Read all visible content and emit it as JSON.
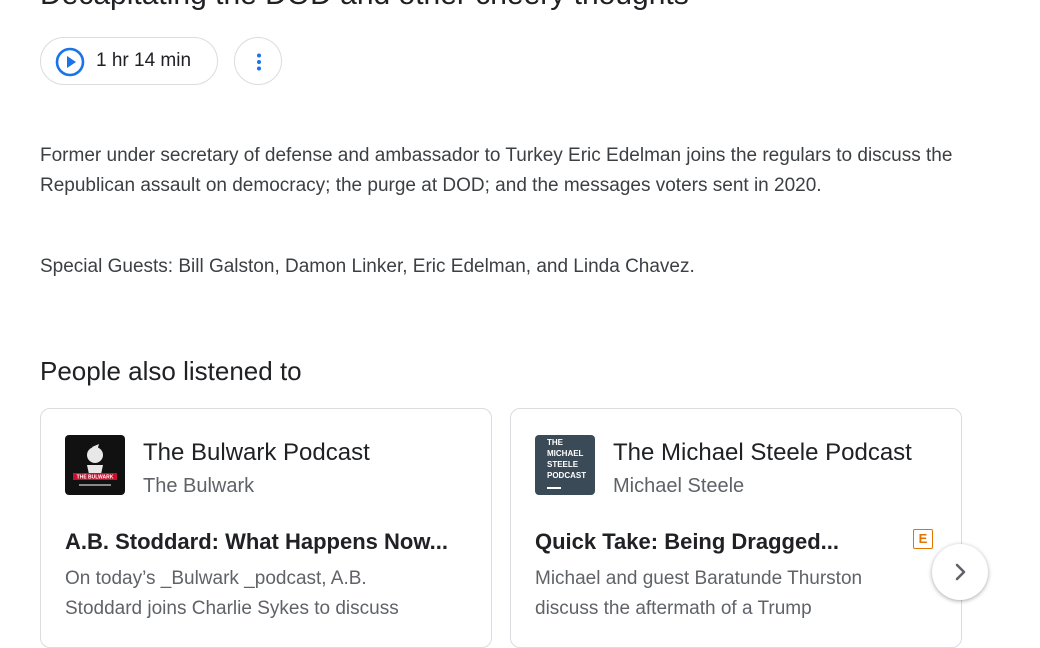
{
  "episode": {
    "title": "Decapitating the DOD and other cheery thoughts",
    "duration": "1 hr 14 min",
    "description": "Former under secretary of defense and ambassador to Turkey Eric Edelman joins the regulars to discuss the Republican assault on democracy; the purge at DOD; and the messages voters sent in 2020.",
    "guests": "Special Guests: Bill Galston, Damon Linker, Eric Edelman, and Linda Chavez."
  },
  "icons": {
    "play": "play-circle-icon",
    "more": "more-vert-icon",
    "explicit": "explicit-icon",
    "next": "chevron-right-icon"
  },
  "colors": {
    "accent": "#1a73e8",
    "explicit": "#e37400",
    "text_primary": "#202124",
    "text_secondary": "#5f6368"
  },
  "related": {
    "title": "People also listened to",
    "cards": [
      {
        "show": "The Bulwark Podcast",
        "publisher": "The Bulwark",
        "episode_title": "A.B. Stoddard: What Happens Now...",
        "episode_desc": "On today’s _Bulwark _podcast, A.B. Stoddard joins Charlie Sykes to discuss",
        "art_text": "THE BULWARK",
        "explicit": false
      },
      {
        "show": "The Michael Steele Podcast",
        "publisher": "Michael Steele",
        "episode_title": "Quick Take: Being Dragged...",
        "episode_desc": "Michael and guest Baratunde Thurston discuss the aftermath of a Trump",
        "art_text": "THE MICHAEL STEELE PODCAST",
        "explicit": true,
        "explicit_label": "E"
      }
    ]
  }
}
